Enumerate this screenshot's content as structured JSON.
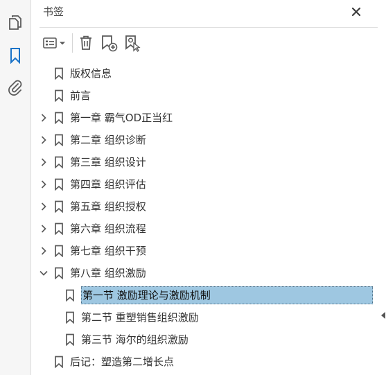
{
  "panel": {
    "title": "书签",
    "close_icon": "close-icon"
  },
  "rail": {
    "items": [
      {
        "name": "pages-icon"
      },
      {
        "name": "bookmark-icon",
        "active": true
      },
      {
        "name": "attachment-icon"
      }
    ]
  },
  "toolbar": {
    "items": [
      {
        "name": "options-menu-icon"
      },
      {
        "name": "delete-icon"
      },
      {
        "name": "new-bookmark-icon"
      },
      {
        "name": "new-bookmark-from-structure-icon"
      }
    ]
  },
  "bookmarks": [
    {
      "label": "版权信息",
      "level": 0,
      "expandable": false
    },
    {
      "label": "前言",
      "level": 0,
      "expandable": false
    },
    {
      "label": "第一章 霸气OD正当红",
      "level": 0,
      "expandable": true,
      "expanded": false
    },
    {
      "label": "第二章 组织诊断",
      "level": 0,
      "expandable": true,
      "expanded": false
    },
    {
      "label": "第三章 组织设计",
      "level": 0,
      "expandable": true,
      "expanded": false
    },
    {
      "label": "第四章 组织评估",
      "level": 0,
      "expandable": true,
      "expanded": false
    },
    {
      "label": "第五章 组织授权",
      "level": 0,
      "expandable": true,
      "expanded": false
    },
    {
      "label": "第六章 组织流程",
      "level": 0,
      "expandable": true,
      "expanded": false
    },
    {
      "label": "第七章 组织干预",
      "level": 0,
      "expandable": true,
      "expanded": false
    },
    {
      "label": "第八章 组织激励",
      "level": 0,
      "expandable": true,
      "expanded": true
    },
    {
      "label": "第一节 激励理论与激励机制",
      "level": 1,
      "expandable": false,
      "selected": true
    },
    {
      "label": "第二节 重塑销售组织激励",
      "level": 1,
      "expandable": false
    },
    {
      "label": "第三节 海尔的组织激励",
      "level": 1,
      "expandable": false
    },
    {
      "label": "后记：塑造第二增长点",
      "level": 0,
      "expandable": false
    }
  ],
  "colors": {
    "accent": "#1a73c8",
    "selection": "#9ec7e1",
    "icon": "#5a5a5a"
  }
}
